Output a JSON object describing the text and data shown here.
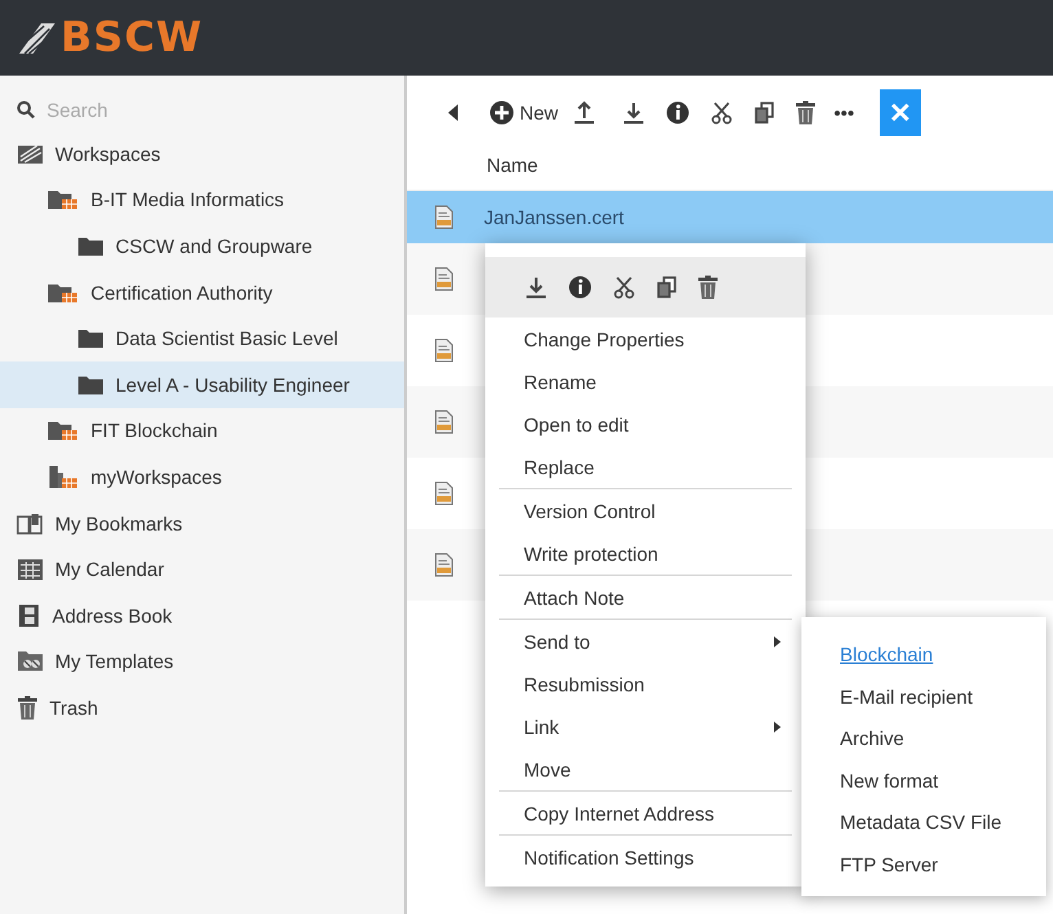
{
  "header": {
    "logo": "BSCW"
  },
  "sidebar": {
    "search": {
      "placeholder": "Search"
    },
    "tree": [
      {
        "label": "Workspaces",
        "kind": "workspaces",
        "selected": false,
        "children": [
          {
            "label": "B-IT Media Informatics",
            "kind": "shared-folder",
            "selected": false,
            "children": [
              {
                "label": "CSCW and Groupware",
                "kind": "folder",
                "selected": false
              }
            ]
          },
          {
            "label": "Certification Authority",
            "kind": "shared-folder",
            "selected": false,
            "children": [
              {
                "label": "Data Scientist Basic Level",
                "kind": "folder",
                "selected": false
              },
              {
                "label": "Level A - Usability Engineer",
                "kind": "folder",
                "selected": true
              }
            ]
          },
          {
            "label": "FIT Blockchain",
            "kind": "shared-folder",
            "selected": false
          },
          {
            "label": "myWorkspaces",
            "kind": "my-folder",
            "selected": false
          }
        ]
      },
      {
        "label": "My Bookmarks",
        "kind": "bookmarks",
        "selected": false
      },
      {
        "label": "My Calendar",
        "kind": "calendar",
        "selected": false
      },
      {
        "label": "Address Book",
        "kind": "address-book",
        "selected": false
      },
      {
        "label": "My Templates",
        "kind": "templates",
        "selected": false
      },
      {
        "label": "Trash",
        "kind": "trash",
        "selected": false
      }
    ]
  },
  "toolbar": {
    "new_label": "New",
    "more": "•••",
    "close": "✕"
  },
  "table": {
    "columns": [
      "Name"
    ],
    "rows": [
      {
        "name": "JanJanssen.cert",
        "selected": true
      },
      {
        "selected": false
      },
      {
        "selected": false
      },
      {
        "selected": false
      },
      {
        "selected": false
      },
      {
        "selected": false
      }
    ]
  },
  "context_menu": {
    "sections": [
      [
        {
          "label": "Change Properties"
        },
        {
          "label": "Rename"
        },
        {
          "label": "Open to edit"
        },
        {
          "label": "Replace"
        }
      ],
      [
        {
          "label": "Version Control"
        },
        {
          "label": "Write protection"
        }
      ],
      [
        {
          "label": "Attach Note"
        }
      ],
      [
        {
          "label": "Send to",
          "has_submenu": true
        },
        {
          "label": "Resubmission",
          "has_submenu": false
        },
        {
          "label": "Link",
          "has_submenu": true
        },
        {
          "label": "Move",
          "has_submenu": false
        }
      ],
      [
        {
          "label": "Copy Internet Address"
        }
      ],
      [
        {
          "label": "Notification Settings"
        }
      ]
    ]
  },
  "submenu": {
    "items": [
      {
        "label": "Blockchain",
        "selected": true
      },
      {
        "label": "E-Mail recipient",
        "selected": false
      },
      {
        "label": "Archive",
        "selected": false
      },
      {
        "label": "New format",
        "selected": false
      },
      {
        "label": "Metadata CSV File",
        "selected": false
      },
      {
        "label": "FTP Server",
        "selected": false
      }
    ]
  }
}
